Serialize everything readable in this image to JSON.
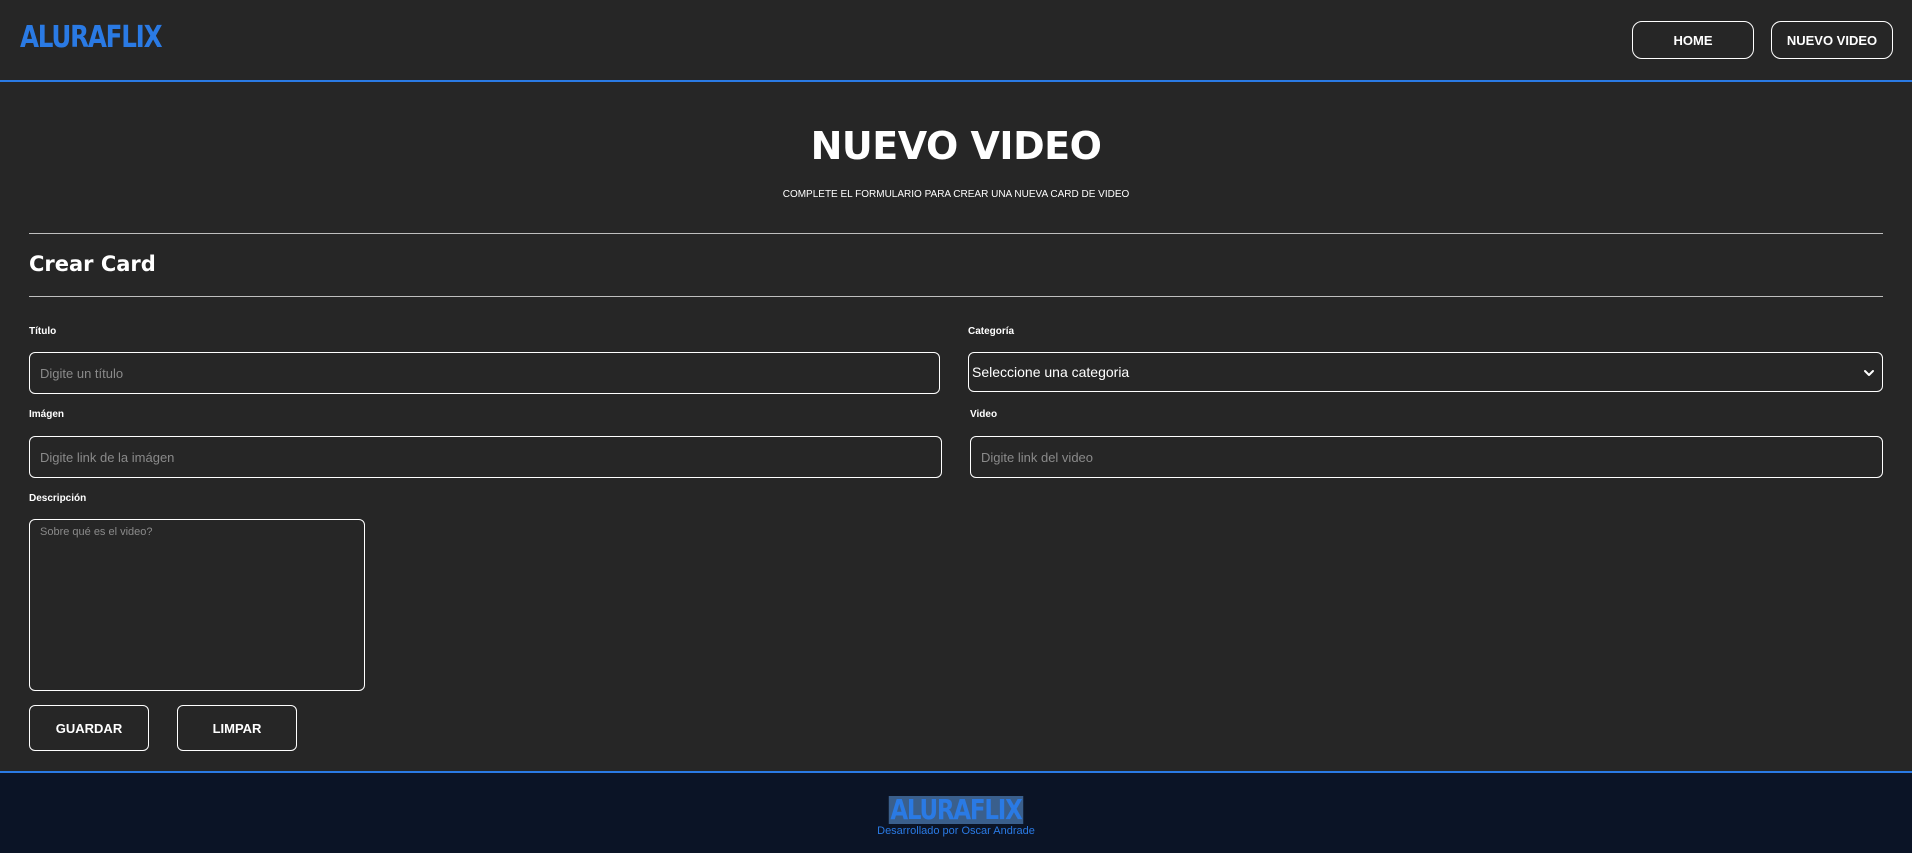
{
  "header": {
    "logo": "ALURAFLIX",
    "nav": {
      "home_label": "HOME",
      "new_video_label": "NUEVO VIDEO"
    }
  },
  "main": {
    "title": "NUEVO VIDEO",
    "subtitle": "COMPLETE EL FORMULARIO PARA CREAR UNA NUEVA CARD DE VIDEO",
    "section_title": "Crear Card",
    "form": {
      "titulo": {
        "label": "Título",
        "placeholder": "Digite un título",
        "value": ""
      },
      "categoria": {
        "label": "Categoría",
        "selected": "Seleccione una categoria"
      },
      "imagen": {
        "label": "Imágen",
        "placeholder": "Digite link de la imágen",
        "value": ""
      },
      "video": {
        "label": "Video",
        "placeholder": "Digite link del video",
        "value": ""
      },
      "descripcion": {
        "label": "Descripción",
        "placeholder": "Sobre qué es el video?",
        "value": ""
      }
    },
    "actions": {
      "save_label": "GUARDAR",
      "clear_label": "LIMPAR"
    }
  },
  "footer": {
    "logo": "ALURAFLIX",
    "credit": "Desarrollado por Oscar Andrade"
  },
  "colors": {
    "accent": "#2a7ae4",
    "background": "#262626",
    "footer_background": "#0b1426"
  }
}
